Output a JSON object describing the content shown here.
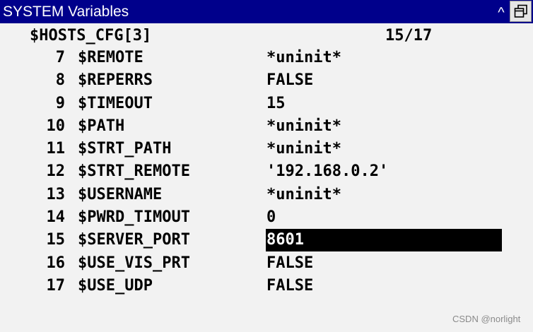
{
  "window": {
    "title": "SYSTEM Variables",
    "caret_glyph": "^",
    "restore_icon": "restore-window-icon"
  },
  "header": {
    "variable": "$HOSTS_CFG[3]",
    "position": "15/17"
  },
  "variables": [
    {
      "num": "7",
      "name": "$REMOTE",
      "value": "*uninit*"
    },
    {
      "num": "8",
      "name": "$REPERRS",
      "value": "FALSE"
    },
    {
      "num": "9",
      "name": "$TIMEOUT",
      "value": "15"
    },
    {
      "num": "10",
      "name": "$PATH",
      "value": "*uninit*"
    },
    {
      "num": "11",
      "name": "$STRT_PATH",
      "value": "*uninit*"
    },
    {
      "num": "12",
      "name": "$STRT_REMOTE",
      "value": "'192.168.0.2'"
    },
    {
      "num": "13",
      "name": "$USERNAME",
      "value": "*uninit*"
    },
    {
      "num": "14",
      "name": "$PWRD_TIMOUT",
      "value": "0"
    },
    {
      "num": "15",
      "name": "$SERVER_PORT",
      "value": "8601",
      "selected": true
    },
    {
      "num": "16",
      "name": "$USE_VIS_PRT",
      "value": "FALSE"
    },
    {
      "num": "17",
      "name": "$USE_UDP",
      "value": "FALSE"
    }
  ],
  "watermark": "CSDN @norlight",
  "colors": {
    "titlebar": "#00008b",
    "background": "#f2f2f2",
    "selection": "#000000"
  }
}
